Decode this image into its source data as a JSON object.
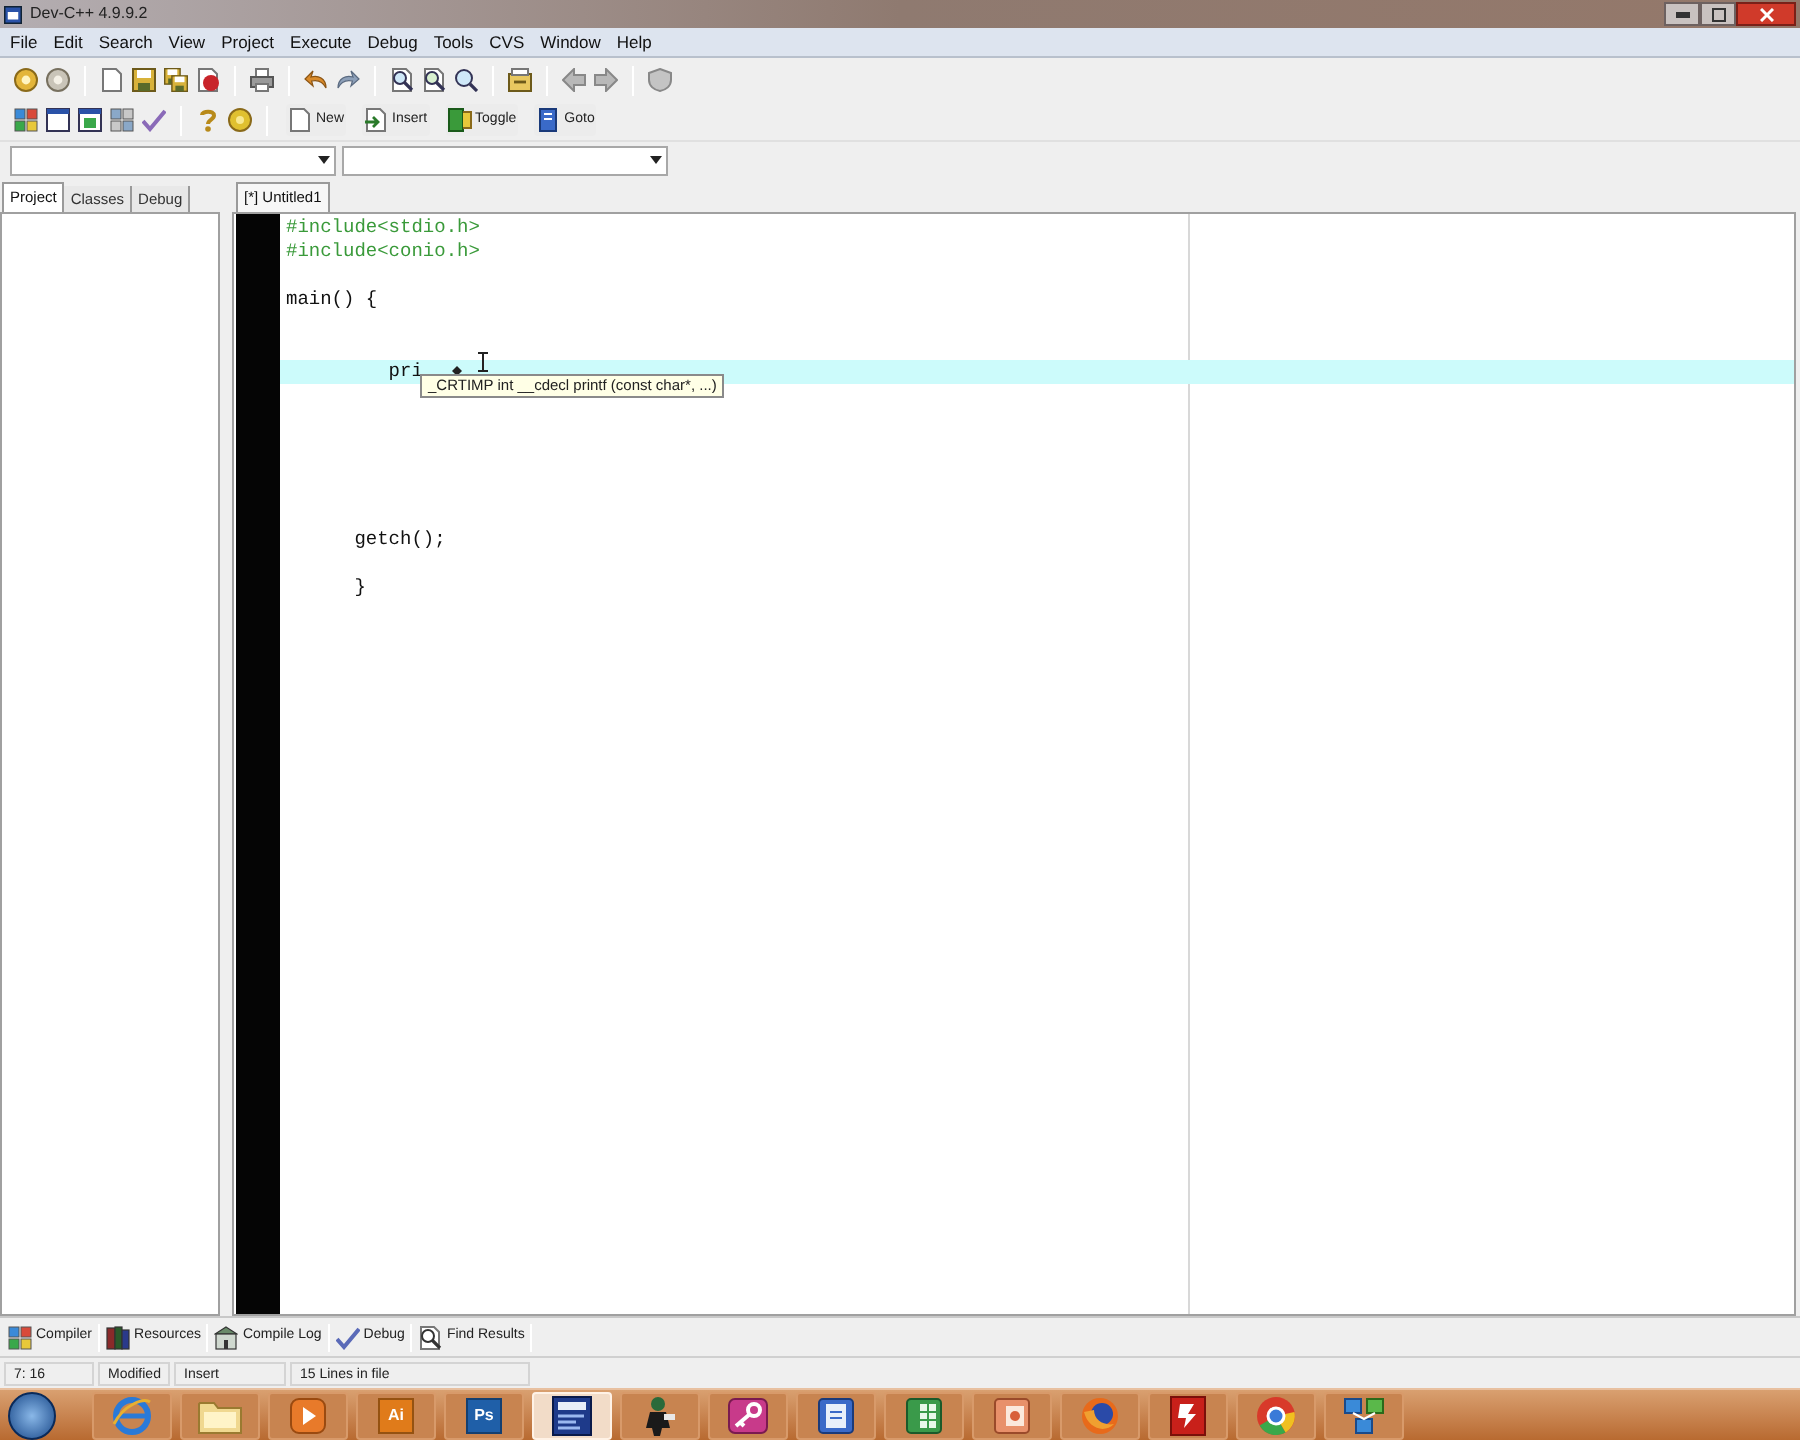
{
  "window": {
    "title": "Dev-C++ 4.9.9.2"
  },
  "menu_bar": [
    "File",
    "Edit",
    "Search",
    "View",
    "Project",
    "Execute",
    "Debug",
    "Tools",
    "CVS",
    "Window",
    "Help"
  ],
  "toolbar": {
    "buttons": [
      {
        "kind": "new",
        "label": "New"
      },
      {
        "kind": "insert",
        "label": "Insert"
      },
      {
        "kind": "toggle",
        "label": "Toggle"
      },
      {
        "kind": "goto",
        "label": "Goto"
      }
    ]
  },
  "side_panel": {
    "tabs": [
      {
        "label": "Project",
        "selected": true
      },
      {
        "label": "Classes",
        "selected": false
      },
      {
        "label": "Debug",
        "selected": false
      }
    ]
  },
  "editor": {
    "tabs": [
      {
        "label": "[*] Untitled1",
        "selected": true
      }
    ],
    "lines": [
      {
        "kind": "directive",
        "text": "#include<stdio.h>",
        "current": false
      },
      {
        "kind": "directive",
        "text": "#include<conio.h>",
        "current": false
      },
      {
        "kind": "blank",
        "current": false
      },
      {
        "kind": "code",
        "text": "main() {",
        "current": false
      },
      {
        "kind": "blank",
        "current": false
      },
      {
        "kind": "blank",
        "current": false
      },
      {
        "kind": "code",
        "text": "         pri",
        "current": true
      },
      {
        "kind": "blank",
        "current": false
      },
      {
        "kind": "blank",
        "current": false
      },
      {
        "kind": "blank",
        "current": false
      },
      {
        "kind": "blank",
        "current": false
      },
      {
        "kind": "blank",
        "current": false
      },
      {
        "kind": "blank",
        "current": false
      },
      {
        "kind": "code",
        "text": "      getch();",
        "current": false
      },
      {
        "kind": "blank",
        "current": false
      },
      {
        "kind": "code",
        "text": "      }",
        "current": false
      }
    ],
    "tooltip": "_CRTIMP int __cdecl printf (const char*, ...)"
  },
  "bottom_tabs": [
    {
      "kind": "compiler",
      "label": "Compiler"
    },
    {
      "kind": "resources",
      "label": "Resources"
    },
    {
      "kind": "log",
      "label": "Compile Log"
    },
    {
      "kind": "debug",
      "label": "Debug"
    },
    {
      "kind": "find",
      "label": "Find Results"
    }
  ],
  "status_bar": [
    "7: 16",
    "Modified",
    "Insert",
    "15 Lines in file"
  ],
  "taskbar": {
    "apps": [
      {
        "kind": "globe",
        "selected": false
      },
      {
        "kind": "folder",
        "selected": false
      },
      {
        "kind": "media",
        "selected": false
      },
      {
        "kind": "tile",
        "label": "Ai",
        "color": "#e07b1a",
        "selected": false
      },
      {
        "kind": "tile",
        "label": "Ps",
        "color": "#1f5fa8",
        "selected": false
      },
      {
        "kind": "ide",
        "selected": true
      },
      {
        "kind": "figure",
        "selected": false
      },
      {
        "kind": "key",
        "selected": false
      },
      {
        "kind": "doc",
        "selected": false
      },
      {
        "kind": "sheet",
        "selected": false
      },
      {
        "kind": "slides",
        "selected": false
      },
      {
        "kind": "flame",
        "selected": false
      },
      {
        "kind": "red",
        "selected": false
      },
      {
        "kind": "ring",
        "selected": false
      },
      {
        "kind": "network",
        "selected": false
      }
    ]
  }
}
